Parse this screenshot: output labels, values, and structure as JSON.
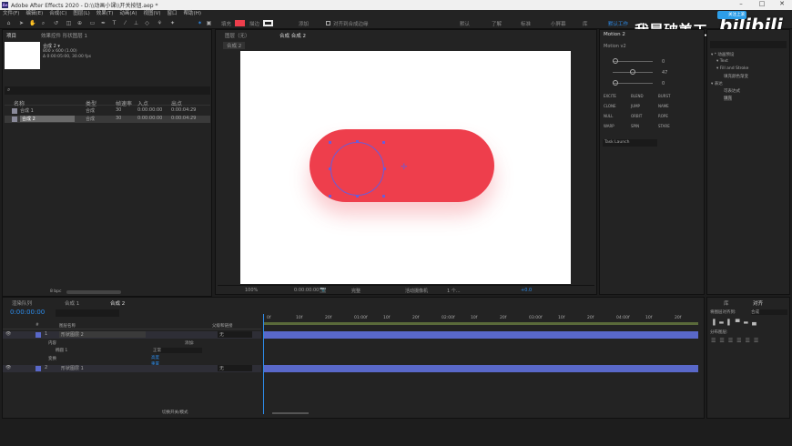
{
  "app": {
    "title": "Adobe After Effects 2020 - D:\\\\动画小课\\\\开关按钮.aep *",
    "logo": "Ae"
  },
  "menu": [
    "文件(F)",
    "编辑(E)",
    "合成(C)",
    "图层(L)",
    "效果(T)",
    "动画(A)",
    "视图(V)",
    "窗口",
    "帮助(H)"
  ],
  "toolbar": {
    "fill_label": "填充",
    "stroke_label": "描边",
    "add_label": "添加",
    "snap_label": "对齐到合成边缘",
    "workspaces": [
      "默认",
      "了解",
      "标准",
      "小屏幕",
      "库"
    ],
    "active_ws": "默认工作"
  },
  "watermark": {
    "text": "我是破美工",
    "brand": "bilibili",
    "follow": "关注上滚"
  },
  "project": {
    "tab": "项目",
    "tab2": "效果控件 形状图层 1",
    "comp_name": "合成 2 ▾",
    "comp_size": "800 x 600 (1.00)",
    "comp_dur": "Δ 0:00:05:00, 30.00 fps",
    "search_placeholder": "⌕",
    "headers": [
      "名称",
      "类型",
      "帧速率",
      "入点",
      "出点"
    ],
    "items": [
      {
        "name": "合成 1",
        "type": "合成",
        "fps": "30",
        "in": "0:00:00:00",
        "out": "0:00:04:29"
      },
      {
        "name": "合成 2",
        "type": "合成",
        "fps": "30",
        "in": "0:00:00:00",
        "out": "0:00:04:29"
      }
    ],
    "bpc": "8 bpc"
  },
  "viewer": {
    "tab_layer": "图层（无）",
    "tab_comp": "合成 合成 2",
    "crumb": "合成 2",
    "zoom": "100%",
    "time": "0:00:00:00",
    "res": "完整",
    "camera": "活动摄像机",
    "views": "1 个...",
    "exposure": "+0.0"
  },
  "motion": {
    "tab": "Motion 2",
    "ver": "Motion v2",
    "v1": "0",
    "v2": "47",
    "v3": "0",
    "buttons": [
      "EXCITE",
      "BLEND",
      "BURST",
      "CLONE",
      "JUMP",
      "NAME",
      "NULL",
      "ORBIT",
      "ROPE",
      "WARP",
      "SPIN",
      "STARE"
    ],
    "launch": "Task Launch"
  },
  "effects": {
    "items": [
      "▾ * 动画预设",
      "▾ Text",
      "▾ Fill and Stroke",
      "填充颜色渐变",
      "▾ 表达",
      "可表达式",
      "填充"
    ]
  },
  "align": {
    "tab1": "库",
    "tab2": "对齐",
    "align_to": "将图层对齐到:",
    "target": "合成",
    "distribute": "分布图层:"
  },
  "timeline": {
    "tabs": [
      "渲染队列",
      "合成 1",
      "合成 2"
    ],
    "time": "0:00:00:00",
    "headers": [
      "#",
      "图层名称",
      "父级和链接"
    ],
    "ruler": [
      "0f",
      "10f",
      "20f",
      "01:00f",
      "10f",
      "20f",
      "02:00f",
      "10f",
      "20f",
      "03:00f",
      "10f",
      "20f",
      "04:00f",
      "10f",
      "20f"
    ],
    "layers": [
      {
        "num": "1",
        "name": "形状图层 2",
        "parent": "无"
      },
      {
        "num": "2",
        "name": "形状图层 1",
        "parent": "无"
      }
    ],
    "sub": [
      "内容",
      "添加:",
      "椭圆 1",
      "正常",
      "高度",
      "变换",
      "重置"
    ],
    "footer": "切换开关/模式"
  },
  "colors": {
    "accent": "#2d8ceb",
    "pill": "#ee3e4c",
    "layer_bar": "#5968c9"
  }
}
